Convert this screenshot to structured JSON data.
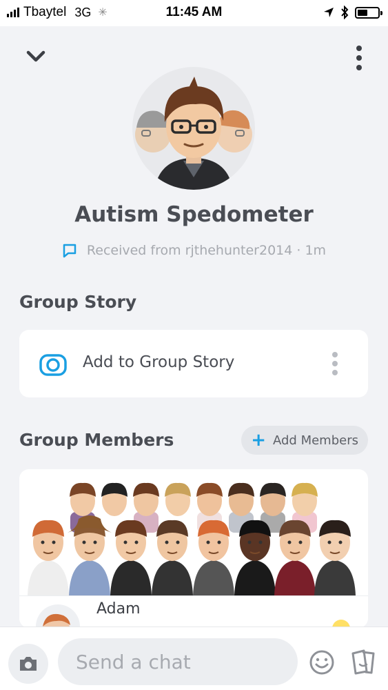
{
  "status_bar": {
    "carrier": "Tbaytel",
    "network": "3G",
    "time": "11:45 AM"
  },
  "group": {
    "name": "Autism Spedometer",
    "received": "Received from rjthehunter2014 · 1m"
  },
  "group_story": {
    "title": "Group Story",
    "add_label": "Add to Group Story"
  },
  "group_members": {
    "title": "Group Members",
    "add_button": "Add Members",
    "members": [
      {
        "name": "Adam"
      }
    ]
  },
  "chat": {
    "placeholder": "Send a chat"
  },
  "colors": {
    "accent": "#1a9fe2",
    "background": "#f2f3f6",
    "card": "#ffffff",
    "title_text": "#4a4d54",
    "muted_text": "#a6a9af"
  },
  "icons": [
    "chevron-down-icon",
    "more-vertical-icon",
    "chat-bubble-icon",
    "camera-icon",
    "plus-icon",
    "smile-icon",
    "sticker-icon"
  ]
}
